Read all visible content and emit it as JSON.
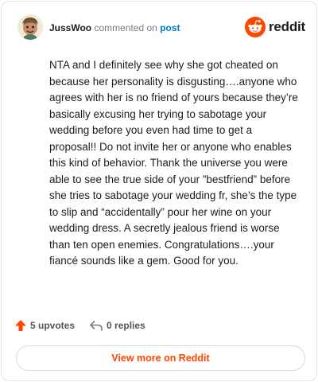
{
  "comment": {
    "username": "JussWoo",
    "action_text": "commented on",
    "target_text": "post",
    "body": "NTA and I definitely see why she got cheated on because her personality is disgusting….anyone who agrees with her is no friend of yours because they’re basically excusing her trying to sabotage your wedding before you even had time to get a proposal!! Do not invite her or anyone who enables this kind of behavior. Thank the universe you were able to see the true side of your ”bestfriend” before she tries to sabotage your wedding fr, she’s the type to slip and “accidentally” pour her wine on your wedding dress. A secretly jealous friend is worse than ten open enemies. Congratulations….your fiancé sounds like a gem. Good for you."
  },
  "brand": {
    "wordmark": "reddit",
    "icon": "reddit-logo-icon",
    "color": "#ff4500"
  },
  "actions": {
    "upvotes": "5 upvotes",
    "upvote_icon": "upvote-arrow-icon",
    "replies": "0 replies",
    "reply_icon": "reply-arrow-icon"
  },
  "view_more": {
    "label": "View more on Reddit",
    "color": "#ff4500"
  },
  "colors": {
    "link": "#0079d3",
    "muted": "#7c7c7c",
    "border": "#e3e5e8"
  }
}
